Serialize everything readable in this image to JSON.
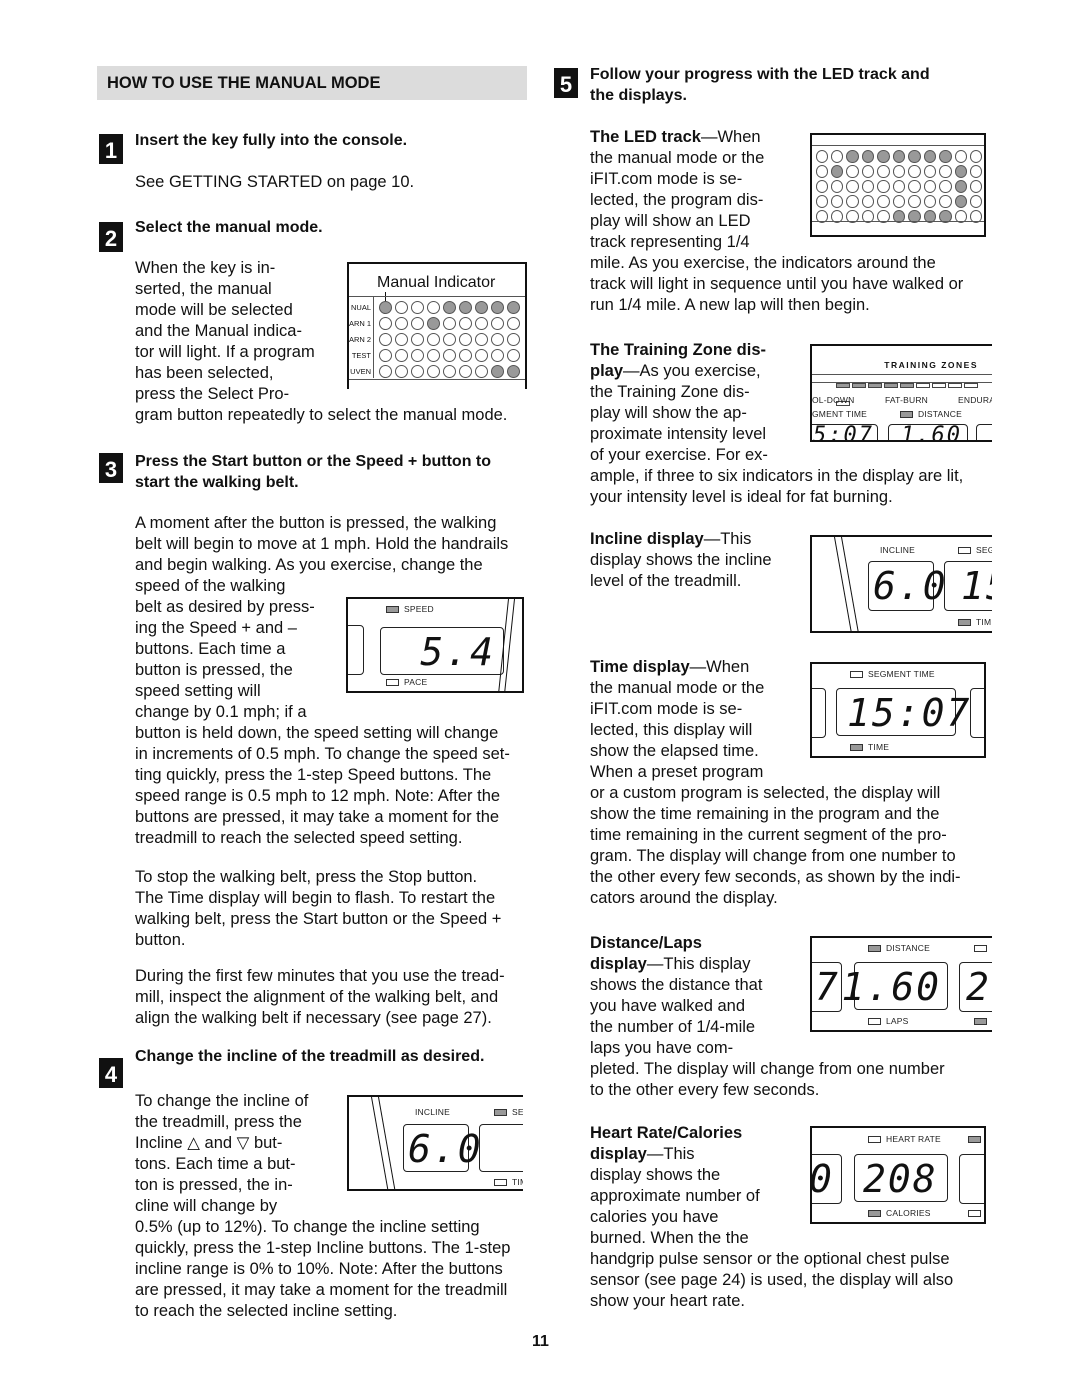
{
  "section_title": "HOW TO USE THE MANUAL MODE",
  "steps": [
    {
      "number": "1",
      "title": "Insert the key fully into the console.",
      "body": "See GETTING STARTED on page 10."
    },
    {
      "number": "2",
      "title": "Select the manual mode.",
      "body_wrapped": [
        "When the key is in-",
        "serted, the manual",
        "mode will be selected",
        "and the Manual indica-",
        "tor will light. If a program",
        "has been selected,",
        "press the Select Pro-"
      ],
      "body_full": "gram button repeatedly to select the manual mode."
    },
    {
      "number": "3",
      "title_lines": [
        "Press the Start button or the Speed + button to",
        "start the walking belt."
      ],
      "para1_full": [
        "A moment after the button is pressed, the walking",
        "belt will begin to move at 1 mph. Hold the handrails",
        "and begin walking. As you exercise, change the",
        "speed of the walking"
      ],
      "para1_wrapped": [
        "belt as desired by press-",
        "ing the Speed + and –",
        "buttons. Each time a",
        "button is pressed, the",
        "speed setting will",
        "change by 0.1 mph; if a"
      ],
      "para1_rest": [
        "button is held down, the speed setting will change",
        "in increments of 0.5 mph. To change the speed set-",
        "ting quickly, press the 1-step Speed buttons. The",
        "speed range is 0.5 mph to 12 mph. Note: After the",
        "buttons are pressed, it may take a moment for the",
        "treadmill to reach the selected speed setting."
      ],
      "para2": [
        "To stop the walking belt, press the Stop button.",
        "The Time display will begin to flash. To restart the",
        "walking belt, press the Start button or the Speed +",
        "button."
      ],
      "para3": [
        "During the first few minutes that you use the tread-",
        "mill, inspect the alignment of the walking belt, and",
        "align the walking belt if necessary (see page 27)."
      ]
    },
    {
      "number": "4",
      "title": "Change the incline of the treadmill as desired.",
      "body_wrapped": [
        "To change the incline of",
        "the treadmill, press the",
        "Incline △ and ▽ but-",
        "tons. Each time a but-",
        "ton is pressed, the in-",
        "cline will change by"
      ],
      "body_rest": [
        "0.5% (up to 12%). To change the incline setting",
        "quickly, press the 1-step Incline buttons. The 1-step",
        "incline range is 0% to 10%. Note: After the buttons",
        "are pressed, it may take a moment for the treadmill",
        "to reach the selected incline setting."
      ]
    },
    {
      "number": "5",
      "title_lines": [
        "Follow your progress with the LED track and",
        "the displays."
      ]
    }
  ],
  "manual_indicator_figure": {
    "caption": "Manual Indicator",
    "rows": [
      {
        "label": "NUAL",
        "leds": [
          1,
          0,
          0,
          0,
          1,
          1,
          1,
          1,
          1
        ]
      },
      {
        "label": "ARN 1",
        "leds": [
          0,
          0,
          0,
          1,
          0,
          0,
          0,
          0,
          0
        ]
      },
      {
        "label": "ARN 2",
        "leds": [
          0,
          0,
          0,
          0,
          0,
          0,
          0,
          0,
          0
        ]
      },
      {
        "label": "TEST",
        "leds": [
          0,
          0,
          0,
          0,
          0,
          0,
          0,
          0,
          0
        ]
      },
      {
        "label": "UVEN",
        "leds": [
          0,
          0,
          0,
          0,
          0,
          0,
          0,
          1,
          1
        ]
      }
    ]
  },
  "speed_figure": {
    "top_label": "SPEED",
    "bottom_label": "PACE",
    "value": "5.4",
    "top_on": true,
    "bottom_on": false
  },
  "incline_figure_left": {
    "label": "INCLINE",
    "value": "6.0",
    "right_top_label": "SEG",
    "right_bottom_label": "TIM"
  },
  "displays": [
    {
      "key": "led_track",
      "heading": "The LED track",
      "wrapped": [
        "—When",
        "the manual mode or the",
        "iFIT.com mode is se-",
        "lected, the program dis-",
        "play will show an LED",
        "track representing 1/4"
      ],
      "rest": [
        "mile. As you exercise, the indicators around the",
        "track will light in sequence until you have walked or",
        "run 1/4 mile. A new lap will then begin."
      ]
    },
    {
      "key": "training_zone",
      "heading_lines": [
        "The Training Zone dis-",
        "play"
      ],
      "wrapped": [
        "—As you exercise,",
        "the Training Zone dis-",
        "play will show the ap-",
        "proximate intensity level",
        "of your exercise. For ex-"
      ],
      "rest": [
        "ample, if three to six indicators in the display are lit,",
        "your intensity level is ideal for fat burning."
      ]
    },
    {
      "key": "incline",
      "heading": "Incline display",
      "wrapped": [
        "—This",
        "display shows the incline",
        "level of the treadmill."
      ]
    },
    {
      "key": "time",
      "heading": "Time display",
      "wrapped": [
        "—When",
        "the manual mode or the",
        "iFIT.com mode is se-",
        "lected, this display will",
        "show the elapsed time.",
        "When a preset program"
      ],
      "rest": [
        "or a custom program is selected, the display will",
        "show the time remaining in the program and the",
        "time remaining in the current segment of the pro-",
        "gram. The display will change from one number to",
        "the other every few seconds, as shown by the indi-",
        "cators around the display."
      ]
    },
    {
      "key": "distance",
      "heading_lines": [
        "Distance/Laps",
        "display"
      ],
      "wrapped": [
        "—This display",
        "shows the distance that",
        "you have walked and",
        "the number of 1/4-mile",
        "laps you have com-"
      ],
      "rest": [
        "pleted. The display will change from one number",
        "to the other every few seconds."
      ]
    },
    {
      "key": "heart",
      "heading_lines": [
        "Heart Rate/Calories",
        "display"
      ],
      "wrapped": [
        "—This",
        "display shows the",
        "approximate number of",
        "calories you have",
        "burned. When the the"
      ],
      "rest": [
        "handgrip pulse sensor or the optional chest pulse",
        "sensor (see page 24) is used, the display will also",
        "show your heart rate."
      ]
    }
  ],
  "led_track_figure": {
    "rows": [
      [
        0,
        0,
        1,
        1,
        1,
        1,
        1,
        1,
        1,
        0,
        0
      ],
      [
        0,
        1,
        0,
        0,
        0,
        0,
        0,
        0,
        0,
        1,
        0
      ],
      [
        0,
        0,
        0,
        0,
        0,
        0,
        0,
        0,
        0,
        1,
        0
      ],
      [
        0,
        0,
        0,
        0,
        0,
        0,
        0,
        0,
        0,
        1,
        0
      ],
      [
        0,
        0,
        0,
        0,
        0,
        1,
        1,
        1,
        1,
        0,
        0
      ]
    ]
  },
  "training_zone_figure": {
    "title": "TRAINING ZONES",
    "zones": [
      "OL-DOWN",
      "FAT-BURN",
      "ENDURA"
    ],
    "segment_label": "GMENT TIME",
    "distance_label": "DISTANCE",
    "lit_segments": 5,
    "total_segments": 10,
    "partial_left": "5:07",
    "partial_right": "1.60"
  },
  "incline_figure_right": {
    "label": "INCLINE",
    "value": "6.0",
    "right_top_label": "SEG",
    "right_bottom_label": "TIM",
    "partial_right": "15"
  },
  "time_figure": {
    "top_label": "SEGMENT TIME",
    "bottom_label": "TIME",
    "value": "15:07"
  },
  "distance_figure": {
    "top_label": "DISTANCE",
    "bottom_label": "LAPS",
    "value": "1.60",
    "partial_left": "7",
    "partial_right": "2"
  },
  "heart_figure": {
    "top_label": "HEART RATE",
    "bottom_label": "CALORIES",
    "value": "208",
    "partial_left": "0"
  },
  "page_number": "11"
}
